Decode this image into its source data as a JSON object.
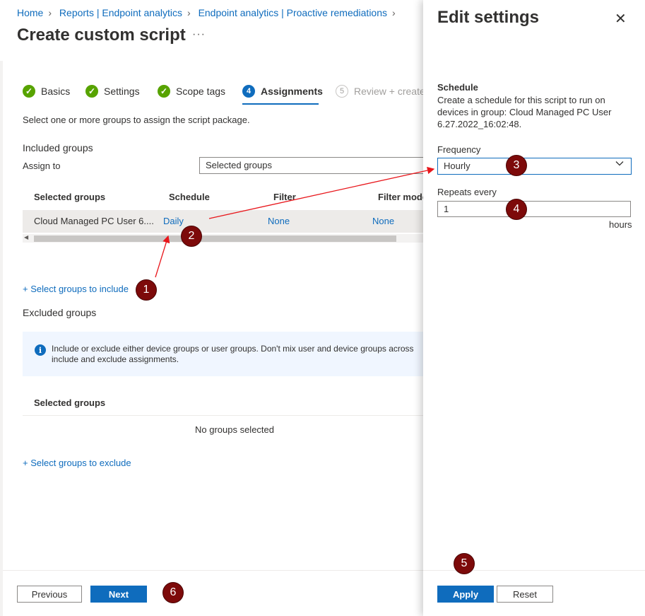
{
  "breadcrumb": [
    "Home",
    "Reports | Endpoint analytics",
    "Endpoint analytics | Proactive remediations"
  ],
  "page_title": "Create custom script",
  "more_label": "···",
  "steps": [
    {
      "label": "Basics",
      "state": "done"
    },
    {
      "label": "Settings",
      "state": "done"
    },
    {
      "label": "Scope tags",
      "state": "done"
    },
    {
      "number": "4",
      "label": "Assignments",
      "state": "active"
    },
    {
      "number": "5",
      "label": "Review + create",
      "state": "upcoming"
    }
  ],
  "intro": "Select one or more groups to assign the script package.",
  "included": {
    "heading": "Included groups",
    "assign_to_label": "Assign to",
    "assign_to_value": "Selected groups",
    "columns": [
      "Selected groups",
      "Schedule",
      "Filter",
      "Filter mode"
    ],
    "row": {
      "group": "Cloud Managed PC User 6....",
      "schedule": "Daily",
      "filter": "None",
      "filter_mode": "None"
    },
    "add_link": "+ Select groups to include"
  },
  "excluded": {
    "heading": "Excluded groups",
    "info": "Include or exclude either device groups or user groups. Don't mix user and device groups across include and exclude assignments.",
    "column": "Selected groups",
    "empty": "No groups selected",
    "add_link": "+ Select groups to exclude"
  },
  "footer": {
    "previous": "Previous",
    "next": "Next"
  },
  "panel": {
    "title": "Edit settings",
    "schedule_heading": "Schedule",
    "schedule_desc": "Create a schedule for this script to run on devices in group: Cloud Managed PC User 6.27.2022_16:02:48.",
    "frequency_label": "Frequency",
    "frequency_value": "Hourly",
    "repeats_label": "Repeats every",
    "repeats_value": "1",
    "repeats_unit": "hours",
    "apply": "Apply",
    "reset": "Reset"
  },
  "callouts": [
    "1",
    "2",
    "3",
    "4",
    "5",
    "6"
  ],
  "colors": {
    "accent": "#0f6cbd",
    "success": "#57a300",
    "callout": "#7d0a0a",
    "arrow": "#e8161b"
  }
}
